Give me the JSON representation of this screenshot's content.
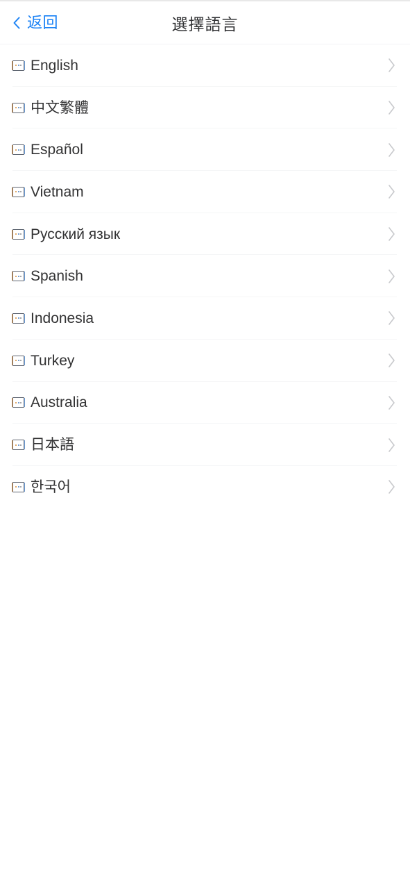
{
  "page": {
    "background_color": "#ffffff"
  },
  "header": {
    "title": "選擇語言",
    "back_label": "返回",
    "back_icon": "chevron-left-icon",
    "back_color": "#1b82f5",
    "title_color": "#303133"
  },
  "list": {
    "item_icon": "broken-image-icon",
    "item_arrow_icon": "chevron-right-icon",
    "arrow_color": "#c8c9cc",
    "divider_color": "#f5f6f7",
    "items": [
      {
        "label": "English"
      },
      {
        "label": "中文繁體"
      },
      {
        "label": "Español"
      },
      {
        "label": "Vietnam"
      },
      {
        "label": "Русский язык"
      },
      {
        "label": "Spanish"
      },
      {
        "label": "Indonesia"
      },
      {
        "label": "Turkey"
      },
      {
        "label": "Australia"
      },
      {
        "label": "日本語"
      },
      {
        "label": "한국어"
      }
    ]
  }
}
